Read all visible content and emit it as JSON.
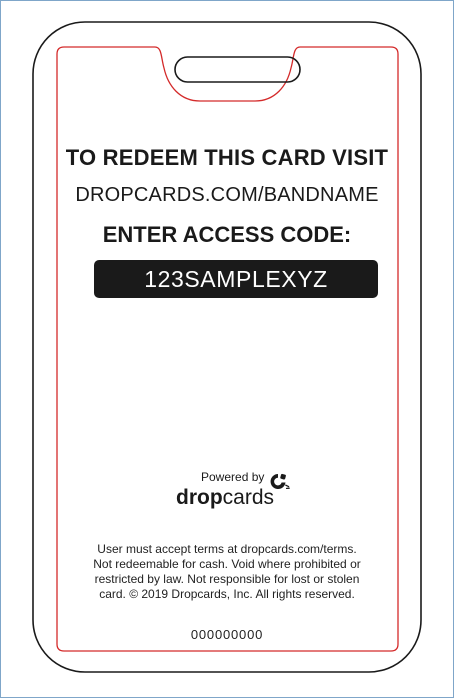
{
  "card": {
    "heading": "TO REDEEM THIS CARD VISIT",
    "url": "DROPCARDS.COM/BANDNAME",
    "access_heading": "ENTER ACCESS CODE:",
    "access_code": "123SAMPLEXYZ",
    "serial": "000000000"
  },
  "branding": {
    "powered_by": "Powered by",
    "brand_bold": "drop",
    "brand_light": "cards",
    "icon": "dropcards-logo-icon"
  },
  "terms": {
    "lines": [
      "User must accept terms at dropcards.com/terms.",
      "Not redeemable for cash. Void where prohibited or",
      "restricted by law. Not responsible for lost or stolen",
      "card. © 2019 Dropcards, Inc. All rights reserved."
    ]
  },
  "colors": {
    "outline": "#1a1a1a",
    "safe_zone": "#d42a2a",
    "code_background": "#1a1a1a",
    "page_frame": "#7fa6c9"
  }
}
